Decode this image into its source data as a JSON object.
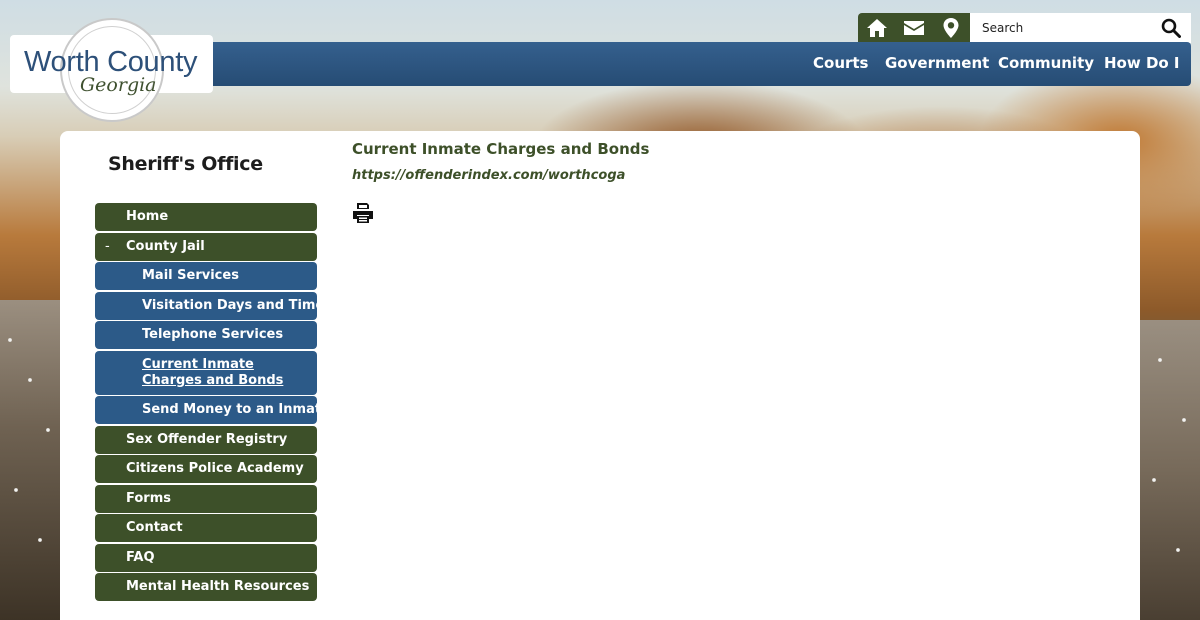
{
  "logo": {
    "main": "Worth County",
    "sub": "Georgia"
  },
  "utility": {
    "icons": [
      "home-icon",
      "mail-icon",
      "map-pin-icon"
    ],
    "search_placeholder": "Search"
  },
  "nav": {
    "items": [
      "Courts",
      "Government",
      "Community",
      "How Do I"
    ]
  },
  "sidebar": {
    "title": "Sheriff's Office",
    "items": [
      {
        "label": "Home",
        "style": "green"
      },
      {
        "label": "County Jail",
        "style": "green",
        "prefix": "-"
      },
      {
        "label": "Mail Services",
        "style": "blue"
      },
      {
        "label": "Visitation Days and Times",
        "style": "blue"
      },
      {
        "label": "Telephone Services",
        "style": "blue"
      },
      {
        "label": "Current Inmate Charges and Bonds",
        "style": "blue",
        "current": true
      },
      {
        "label": "Send Money to an Inmate",
        "style": "blue"
      },
      {
        "label": "Sex Offender Registry",
        "style": "green"
      },
      {
        "label": "Citizens Police Academy",
        "style": "green"
      },
      {
        "label": "Forms",
        "style": "green"
      },
      {
        "label": "Contact",
        "style": "green"
      },
      {
        "label": "FAQ",
        "style": "green"
      },
      {
        "label": "Mental Health Resources",
        "style": "green"
      }
    ]
  },
  "main": {
    "heading": "Current Inmate Charges and Bonds",
    "link": "https://offenderindex.com/worthcoga"
  },
  "colors": {
    "green": "#3d5029",
    "blue": "#2c5a88",
    "nav_blue": "#264c74"
  }
}
